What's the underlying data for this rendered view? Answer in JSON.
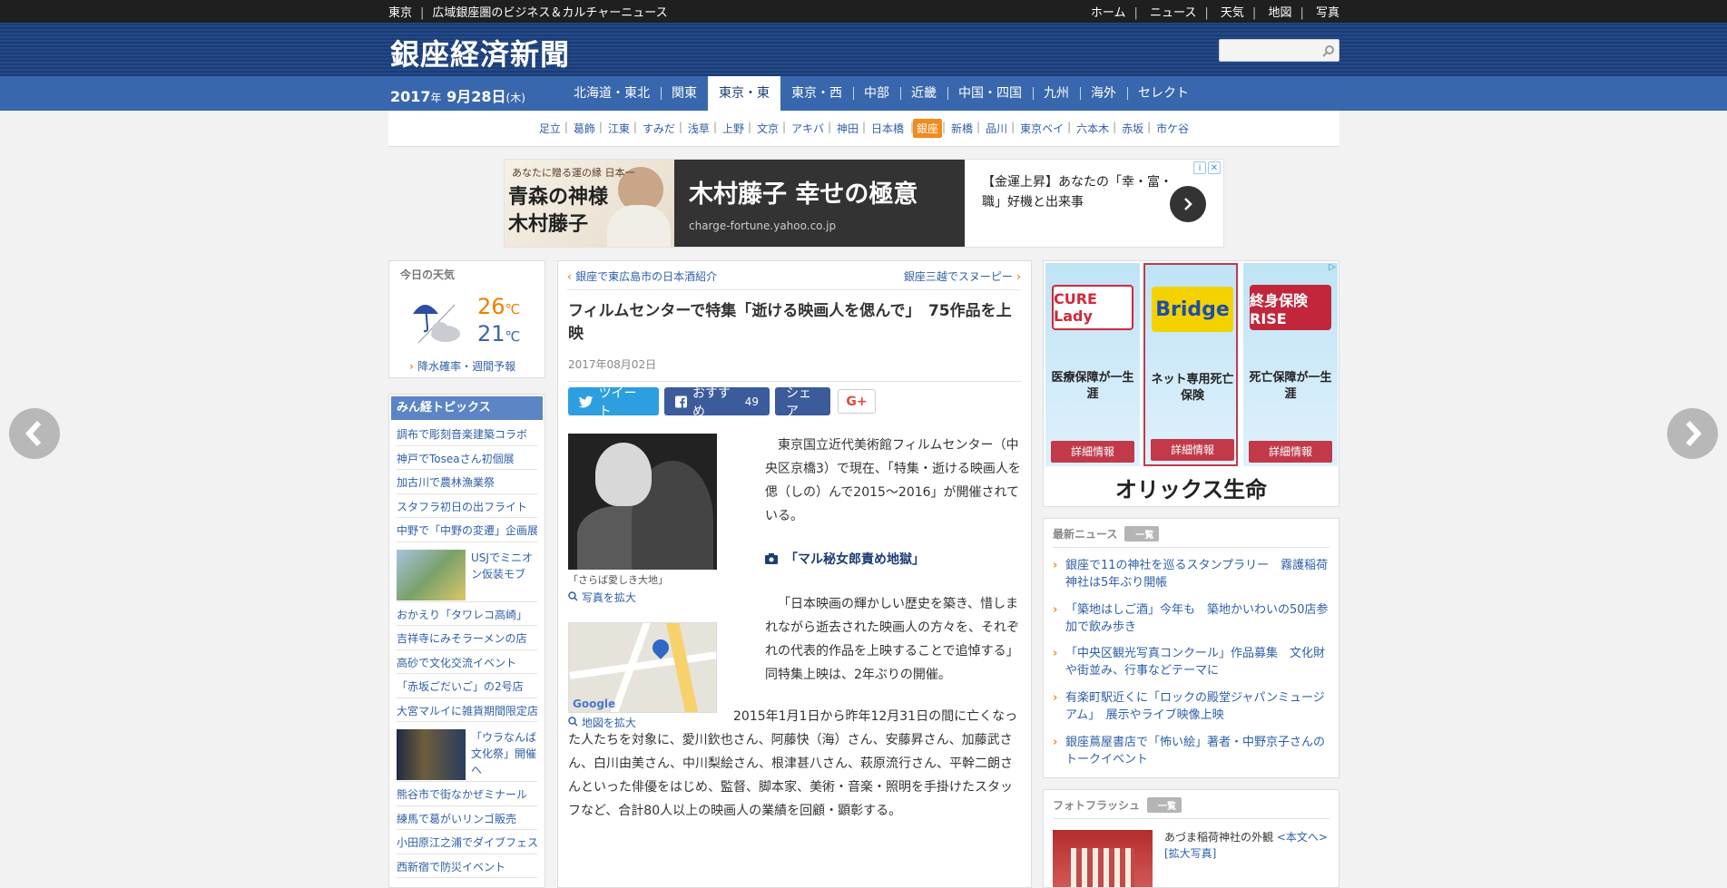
{
  "topbar": {
    "location": "東京",
    "tagline": "広域銀座圏のビジネス＆カルチャーニュース",
    "links": [
      "ホーム",
      "ニュース",
      "天気",
      "地図",
      "写真"
    ]
  },
  "header": {
    "logo": "銀座経済新聞",
    "search_placeholder": ""
  },
  "regionbar": {
    "date_year": "2017",
    "date_year_unit": "年",
    "date_md": "9月28日",
    "date_dow": "(木)",
    "regions": [
      "北海道・東北",
      "関東",
      "東京・東",
      "東京・西",
      "中部",
      "近畿",
      "中国・四国",
      "九州",
      "海外",
      "セレクト"
    ],
    "active_region": "東京・東"
  },
  "areas": {
    "items": [
      "足立",
      "葛飾",
      "江東",
      "すみだ",
      "浅草",
      "上野",
      "文京",
      "アキバ",
      "神田",
      "日本橋",
      "銀座",
      "新橋",
      "品川",
      "東京ベイ",
      "六本木",
      "赤坂",
      "市ケ谷"
    ],
    "active": "銀座"
  },
  "topad": {
    "img_caption": "あなたに贈る運の縁 日本一",
    "img_name": "青森の神様 木村藤子",
    "headline": "木村藤子 幸せの極意",
    "url": "charge-fortune.yahoo.co.jp",
    "text": "【金運上昇】あなたの「幸・富・職」好機と出来事"
  },
  "weather": {
    "title": "今日の天気",
    "high": "26",
    "low": "21",
    "unit": "℃",
    "link": "降水確率・週間予報"
  },
  "topics": {
    "title": "みん経トピックス",
    "items": [
      "調布で彫刻音楽建築コラボ",
      "神戸でToseaさん初個展",
      "加古川で農林漁業祭",
      "スタフラ初日の出フライト",
      "中野で「中野の変遷」企画展",
      "USJでミニオン仮装モブ",
      "おかえり「タワレコ高崎」",
      "吉祥寺にみそラーメンの店",
      "高砂で文化交流イベント",
      "「赤坂ごだいご」の2号店",
      "大宮マルイに雑貨期間限定店",
      "「ウラなんば文化祭」開催へ",
      "熊谷市で街なかぜミナール",
      "練馬で葛がいリンゴ販売",
      "小田原江之浦でダイブフェス",
      "西新宿で防災イベント"
    ]
  },
  "article": {
    "prev": "銀座で東広島市の日本酒紹介",
    "next": "銀座三越でスヌーピー",
    "title": "フィルムセンターで特集「逝ける映画人を偲んで」　75作品を上映",
    "date": "2017年08月02日",
    "share": {
      "tweet": "ツイート",
      "recommend": "おすすめ",
      "recommend_count": "49",
      "share": "シェア",
      "gplus": "G+"
    },
    "photo_caption": "「さらば愛しき大地」",
    "photo_zoom": "写真を拡大",
    "map_zoom": "地図を拡大",
    "map_label": "Google",
    "body1": "東京国立近代美術館フィルムセンター（中央区京橋3）で現在、「特集・逝ける映画人を偲（しの）んで2015～2016」が開催されている。",
    "subhead": "「マル秘女郎責め地獄」",
    "body2": "「日本映画の輝かしい歴史を築き、惜しまれながら逝去された映画人の方々を、それぞれの代表的作品を上映することで追悼する」同特集上映は、2年ぶりの開催。",
    "body3": "2015年1月1日から昨年12月31日の間に亡くなった人たちを対象に、愛川欽也さん、阿藤快（海）さん、安藤昇さん、加藤武さん、白川由美さん、中川梨絵さん、根津甚八さん、萩原流行さん、平幹二朗さんといった俳優をはじめ、監督、脚本家、美術・音楽・照明を手掛けたスタッフなど、合計80人以上の映画人の業績を回顧・顕彰する。"
  },
  "sidead": {
    "cards": [
      {
        "logo": "CURE Lady",
        "text": "医療保障が一生涯",
        "button": "詳細情報"
      },
      {
        "logo": "Bridge",
        "text": "ネット専用死亡保険",
        "button": "詳細情報"
      },
      {
        "logo": "終身保険 RISE",
        "text": "死亡保障が一生涯",
        "button": "詳細情報"
      }
    ],
    "brand": "オリックス生命"
  },
  "latest": {
    "title": "最新ニュース",
    "tag": "一覧",
    "items": [
      "銀座で11の神社を巡るスタンプラリー　霧護稲荷神社は5年ぶり開帳",
      "「築地はしご酒」今年も　築地かいわいの50店参加で飲み歩き",
      "「中央区観光写真コンクール」作品募集　文化財や街並み、行事などテーマに",
      "有楽町駅近くに「ロックの殿堂ジャパンミュージアム」　展示やライブ映像上映",
      "銀座蔦屋書店で「怖い絵」著者・中野京子さんのトークイベント"
    ]
  },
  "flash": {
    "title": "フォトフラッシュ",
    "tag": "一覧",
    "caption": "あづま稲荷神社の外観",
    "link1": "<本文へ>",
    "link2": "[拡大写真]"
  }
}
